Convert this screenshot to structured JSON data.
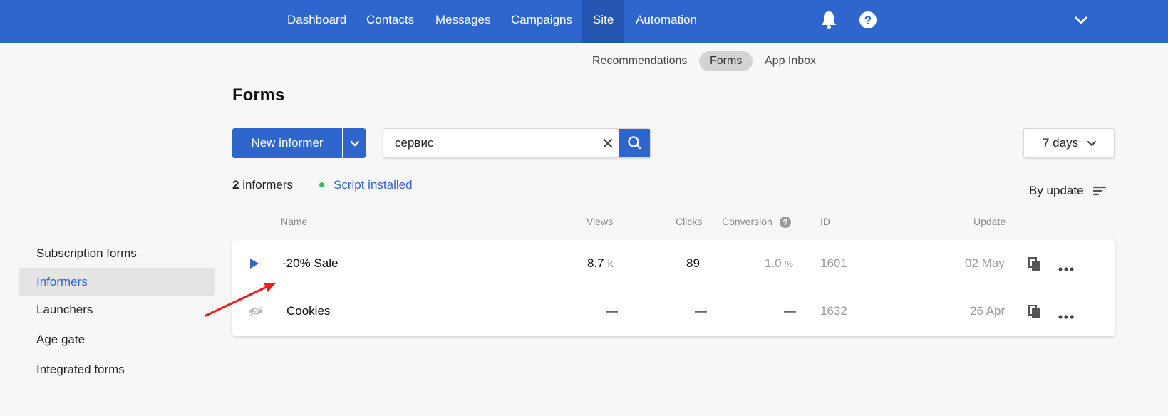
{
  "nav": {
    "items": [
      {
        "label": "Dashboard",
        "active": false
      },
      {
        "label": "Contacts",
        "active": false
      },
      {
        "label": "Messages",
        "active": false
      },
      {
        "label": "Campaigns",
        "active": false
      },
      {
        "label": "Site",
        "active": true
      },
      {
        "label": "Automation",
        "active": false
      }
    ],
    "icons": [
      "bell-icon",
      "help-icon",
      "chevron-down-icon"
    ]
  },
  "subnav": {
    "items": [
      {
        "label": "Recommendations",
        "active": false
      },
      {
        "label": "Forms",
        "active": true
      },
      {
        "label": "App Inbox",
        "active": false
      }
    ]
  },
  "sidebar": {
    "items": [
      {
        "label": "Subscription forms",
        "active": false
      },
      {
        "label": "Informers",
        "active": true
      },
      {
        "label": "Launchers",
        "active": false
      },
      {
        "label": "Age gate",
        "active": false
      },
      {
        "label": "Integrated forms",
        "active": false
      }
    ]
  },
  "page": {
    "title": "Forms",
    "new_button_label": "New informer",
    "search_value": "сервис",
    "days_label": "7 days",
    "count": "2",
    "count_label": "informers",
    "script_status": "Script installed",
    "sort_label": "By update"
  },
  "table": {
    "headers": {
      "name": "Name",
      "views": "Views",
      "clicks": "Clicks",
      "conversion": "Conversion",
      "id": "ID",
      "update": "Update"
    },
    "rows": [
      {
        "status_icon": "play-icon",
        "name": "-20% Sale",
        "views": "8.7",
        "views_unit": "k",
        "clicks": "89",
        "conversion": "1.0",
        "conversion_unit": "%",
        "id": "1601",
        "update": "02 May"
      },
      {
        "status_icon": "eye-off-icon",
        "name": "Cookies",
        "views": "—",
        "views_unit": "",
        "clicks": "—",
        "conversion": "—",
        "conversion_unit": "",
        "id": "1632",
        "update": "26 Apr"
      }
    ]
  },
  "colors": {
    "brand": "#2e66cd",
    "status_green": "#3dbb54",
    "annotation_red": "#ee1c1c"
  }
}
